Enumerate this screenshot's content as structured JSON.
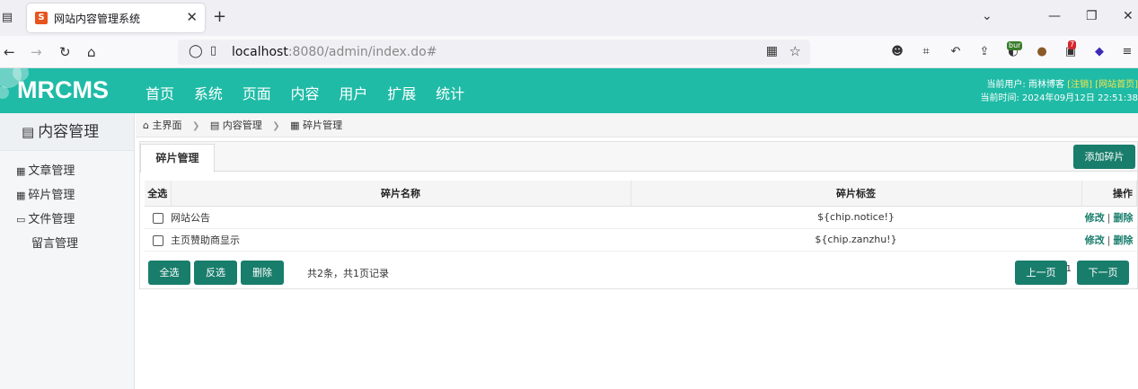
{
  "browser": {
    "tab_title": "网站内容管理系统",
    "tab_favicon": "S",
    "url_host": "localhost",
    "url_rest": ":8080/admin/index.do#",
    "ext_bur_label": "bur",
    "ext_badge_count": "7"
  },
  "header": {
    "logo": "MRCMS",
    "nav": [
      "首页",
      "系统",
      "页面",
      "内容",
      "用户",
      "扩展",
      "统计"
    ],
    "user_prefix": "当前用户: 雨林博客",
    "logout_link": "[注销]",
    "site_home_link": "[网站首页]",
    "time_text": "当前时间: 2024年09月12日 22:51:38",
    "accent_color": "#1fbba6"
  },
  "sidebar": {
    "title": "内容管理",
    "items": [
      {
        "label": "文章管理"
      },
      {
        "label": "碎片管理"
      },
      {
        "label": "文件管理"
      },
      {
        "label": "留言管理"
      }
    ]
  },
  "breadcrumb": {
    "home": "主界面",
    "level1": "内容管理",
    "level2": "碎片管理"
  },
  "panel": {
    "tab_label": "碎片管理",
    "add_button": "添加碎片",
    "columns": {
      "select_all": "全选",
      "name": "碎片名称",
      "tag": "碎片标签",
      "op": "操作"
    },
    "rows": [
      {
        "name": "网站公告",
        "tag": "${chip.notice!}",
        "edit": "修改",
        "sep": "|",
        "delete": "删除"
      },
      {
        "name": "主页赞助商显示",
        "tag": "${chip.zanzhu!}",
        "edit": "修改",
        "sep": "|",
        "delete": "删除"
      }
    ],
    "footer": {
      "select_all": "全选",
      "invert": "反选",
      "delete": "删除",
      "count_text": "共2条，共1页记录",
      "prev": "上一页",
      "page": "1",
      "next": "下一页"
    },
    "button_color": "#197d6c"
  }
}
